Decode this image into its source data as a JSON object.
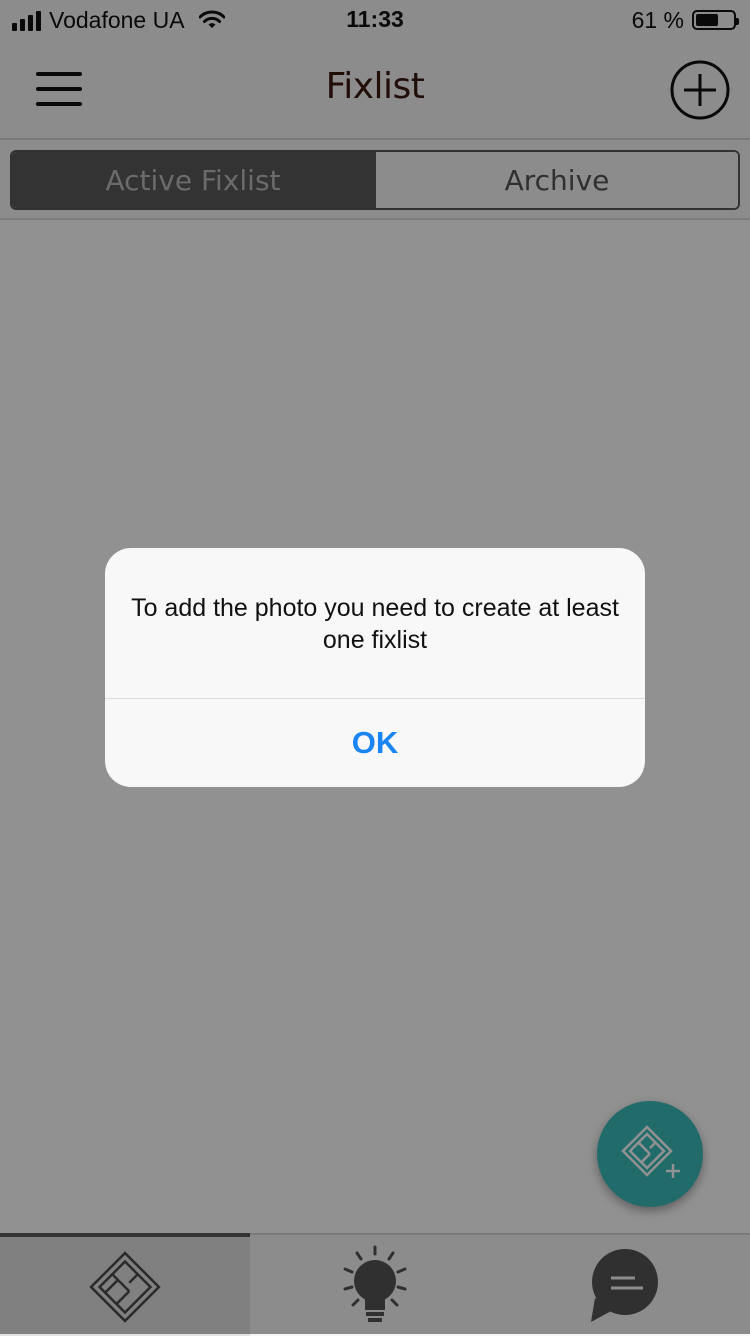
{
  "status_bar": {
    "carrier": "Vodafone UA",
    "time": "11:33",
    "battery_text": "61 %",
    "battery_level": 0.61,
    "signal_bars": 4
  },
  "nav": {
    "title": "Fixlist",
    "menu_icon": "hamburger-menu-icon",
    "add_icon": "add-circle-icon"
  },
  "segments": {
    "active": "Active Fixlist",
    "archive": "Archive"
  },
  "alert": {
    "message": "To add the photo you need to create at least one fixlist",
    "ok_label": "OK"
  },
  "tabs": [
    {
      "icon": "floorplan-icon",
      "active": true
    },
    {
      "icon": "lightbulb-icon",
      "active": false
    },
    {
      "icon": "chat-bubble-icon",
      "active": false
    }
  ],
  "fab": {
    "icon": "add-floorplan-icon"
  },
  "colors": {
    "accent_fab": "#3bbdbb",
    "alert_button": "#1a84f5",
    "segment_active_bg": "#5a5a5a",
    "overlay": "rgba(0,0,0,0.43)"
  }
}
